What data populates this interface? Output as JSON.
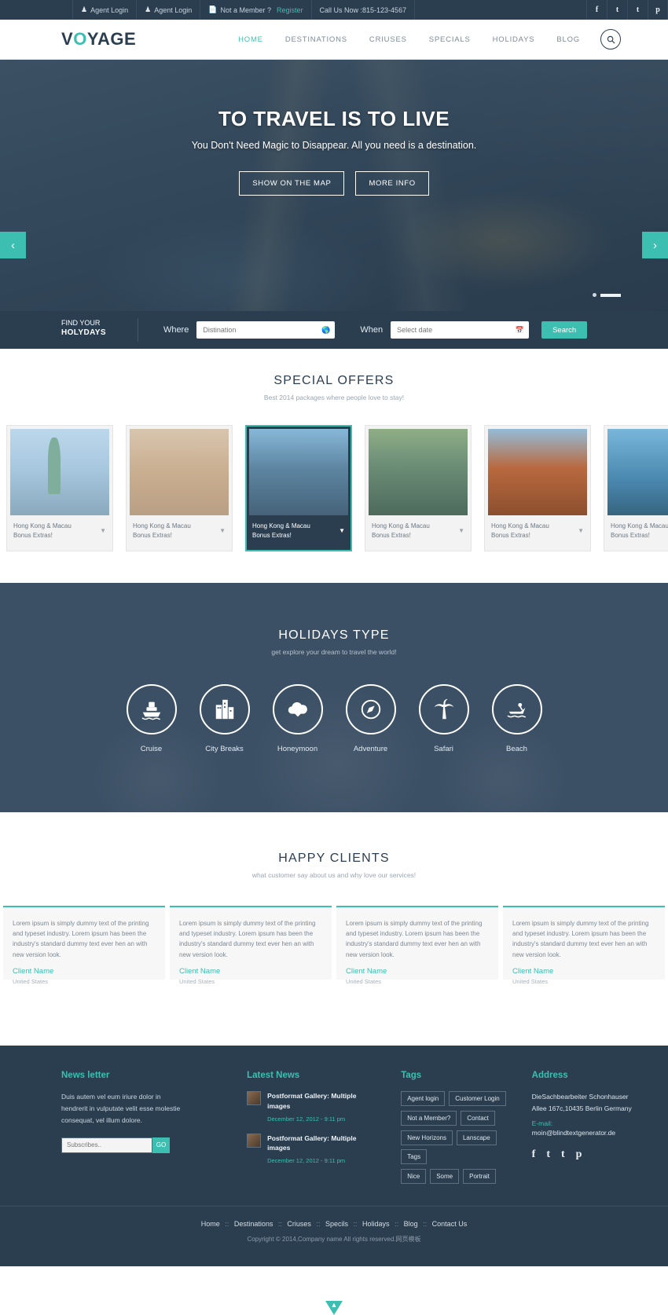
{
  "topbar": {
    "items": [
      {
        "icon": "user-icon",
        "label": "Agent Login"
      },
      {
        "icon": "user-icon",
        "label": "Agent Login"
      },
      {
        "icon": "file-icon",
        "label": "Not a Member ?",
        "link": "Register"
      },
      {
        "icon": "",
        "label": "Call Us Now :815-123-4567"
      }
    ],
    "social": [
      "f",
      "t",
      "t",
      "p"
    ]
  },
  "header": {
    "logo_pre": "V",
    "logo_o": "O",
    "logo_post": "YAGE",
    "nav": [
      {
        "label": "HOME",
        "active": true
      },
      {
        "label": "DESTINATIONS",
        "active": false
      },
      {
        "label": "CRIUSES",
        "active": false
      },
      {
        "label": "SPECIALS",
        "active": false
      },
      {
        "label": "HOLIDAYS",
        "active": false
      },
      {
        "label": "BLOG",
        "active": false
      }
    ],
    "search_icon": "search-icon"
  },
  "hero": {
    "title": "TO TRAVEL IS TO LIVE",
    "subtitle": "You Don't Need Magic to Disappear. All you need is a destination.",
    "btn_map": "SHOW ON THE MAP",
    "btn_info": "MORE INFO",
    "prev": "‹",
    "next": "›"
  },
  "searchstrip": {
    "find_line1": "FIND YOUR",
    "find_line2": "HOLYDAYS",
    "where_label": "Where",
    "where_placeholder": "Distination",
    "when_label": "When",
    "when_placeholder": "Select date",
    "search_button": "Search"
  },
  "offers": {
    "title": "SPECIAL OFFERS",
    "subtitle": "Best 2014 packages where people love to stay!",
    "cards": [
      {
        "name": "Hong Kong & Macau",
        "extra": "Bonus Extras!",
        "img": "img-liberty",
        "active": false
      },
      {
        "name": "Hong Kong & Macau",
        "extra": "Bonus Extras!",
        "img": "img-trevi",
        "active": false
      },
      {
        "name": "Hong Kong & Macau",
        "extra": "Bonus Extras!",
        "img": "img-harbor",
        "active": true
      },
      {
        "name": "Hong Kong & Macau",
        "extra": "Bonus Extras!",
        "img": "img-eiffel",
        "active": false
      },
      {
        "name": "Hong Kong & Macau",
        "extra": "Bonus Extras!",
        "img": "img-canyon",
        "active": false
      },
      {
        "name": "Hong Kong & Macau",
        "extra": "Bonus Extras!",
        "img": "img-blue",
        "active": false
      }
    ]
  },
  "holidays": {
    "title": "HOLIDAYS TYPE",
    "subtitle": "get explore your dream to travel the world!",
    "types": [
      {
        "label": "Cruise",
        "icon": "ship-icon"
      },
      {
        "label": "City Breaks",
        "icon": "buildings-icon"
      },
      {
        "label": "Honeymoon",
        "icon": "heart-cloud-icon"
      },
      {
        "label": "Adventure",
        "icon": "compass-icon"
      },
      {
        "label": "Safari",
        "icon": "palm-tree-icon"
      },
      {
        "label": "Beach",
        "icon": "jetski-icon"
      }
    ]
  },
  "clients": {
    "title": "HAPPY CLIENTS",
    "subtitle": "what customer say about us and why love our services!",
    "cards": [
      {
        "text": "Lorem ipsum is simply dummy text of the printing and typeset industry. Lorem ipsum has been the industry's standard dummy text ever hen an with new version look.",
        "name": "Client Name",
        "country": "United States"
      },
      {
        "text": "Lorem ipsum is simply dummy text of the printing and typeset industry. Lorem ipsum has been the industry's standard dummy text ever hen an with new version look.",
        "name": "Client Name",
        "country": "United States"
      },
      {
        "text": "Lorem ipsum is simply dummy text of the printing and typeset industry. Lorem ipsum has been the industry's standard dummy text ever hen an with new version look.",
        "name": "Client Name",
        "country": "United States"
      },
      {
        "text": "Lorem ipsum is simply dummy text of the printing and typeset industry. Lorem ipsum has been the industry's standard dummy text ever hen an with new version look.",
        "name": "Client Name",
        "country": "United States"
      }
    ]
  },
  "footer": {
    "newsletter": {
      "title": "News letter",
      "text": "Duis autem vel eum iriure dolor in hendrerit in vulputate velit esse molestie consequat, vel illum dolore.",
      "placeholder": "Subscribes..",
      "button": "GO"
    },
    "latest_news": {
      "title": "Latest News",
      "items": [
        {
          "title": "Postformat Gallery: Multiple images",
          "date": "December 12, 2012 - 9:11 pm"
        },
        {
          "title": "Postformat Gallery: Multiple images",
          "date": "December 12, 2012 - 9:11 pm"
        }
      ]
    },
    "tags": {
      "title": "Tags",
      "rows": [
        [
          "Agent login",
          "Customer Login"
        ],
        [
          "Not a Member?",
          "Contact"
        ],
        [
          "New Horizons",
          "Lanscape",
          "Tags"
        ],
        [
          "Nice",
          "Some",
          "Portrait"
        ]
      ]
    },
    "address": {
      "title": "Address",
      "line1": "DieSachbearbeiter Schonhauser",
      "line2": "Allee 167c,10435 Berlin Germany",
      "email_label": "E-mail:",
      "email": "moin@blindtextgenerator.de",
      "social": [
        "f",
        "t",
        "t",
        "p"
      ]
    },
    "bottom_links": [
      "Home",
      "Destinations",
      "Criuses",
      "Specils",
      "Holidays",
      "Blog",
      "Contact Us"
    ],
    "separator": "::",
    "copyright": "Copyright © 2014,Company name All rights reserved.网页模板",
    "to_top": "▲"
  },
  "colors": {
    "accent": "#3cbfb0",
    "dark": "#2b3e50",
    "muted": "#7c8a96"
  }
}
